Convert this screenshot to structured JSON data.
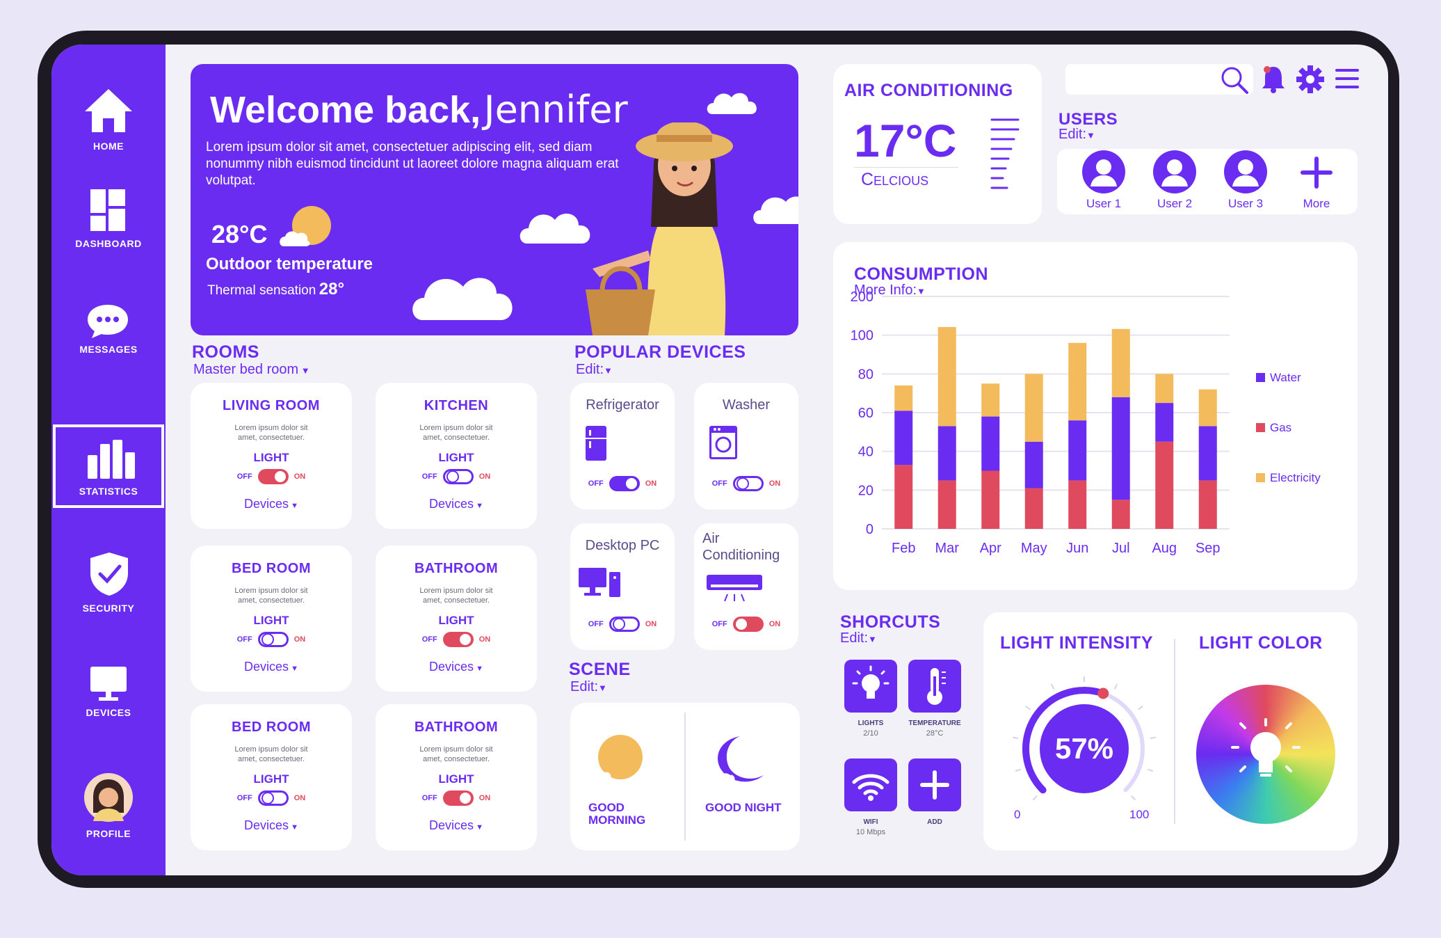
{
  "sidebar": {
    "items": [
      {
        "label": "HOME",
        "icon": "home-icon"
      },
      {
        "label": "DASHBOARD",
        "icon": "dashboard-icon"
      },
      {
        "label": "MESSAGES",
        "icon": "chat-icon"
      },
      {
        "label": "STATISTICS",
        "icon": "bar-chart-icon"
      },
      {
        "label": "SECURITY",
        "icon": "shield-check-icon"
      },
      {
        "label": "DEVICES",
        "icon": "monitor-icon"
      },
      {
        "label": "PROFILE",
        "icon": "avatar"
      }
    ],
    "active": "STATISTICS"
  },
  "welcome": {
    "greeting": "Welcome back,",
    "name": "Jennifer",
    "text": "Lorem ipsum dolor sit amet, consectetuer adipiscing elit, sed diam nonummy nibh euismod tincidunt ut laoreet dolore magna aliquam erat volutpat.",
    "temperature": "28°C",
    "outdoor_label": "Outdoor temperature",
    "thermal_label": "Thermal sensation",
    "thermal_value": "28°"
  },
  "air_conditioning": {
    "title": "AIR CONDITIONING",
    "temperature": "17°C",
    "unit": "Celcious"
  },
  "header": {
    "search_placeholder": "",
    "icons": [
      "search-icon",
      "bell-icon",
      "gear-icon",
      "menu-icon"
    ]
  },
  "users": {
    "title": "USERS",
    "edit": "Edit:",
    "list": [
      "User 1",
      "User 2",
      "User 3"
    ],
    "more": "More"
  },
  "rooms": {
    "title": "ROOMS",
    "subtitle": "Master bed room",
    "list": [
      {
        "name": "LIVING ROOM",
        "desc": "Lorem ipsum dolor sit amet, consectetuer.",
        "light": "LIGHT",
        "state": "on",
        "devices": "Devices"
      },
      {
        "name": "KITCHEN",
        "desc": "Lorem ipsum dolor sit amet, consectetuer.",
        "light": "LIGHT",
        "state": "off",
        "devices": "Devices"
      },
      {
        "name": "BED ROOM",
        "desc": "Lorem ipsum dolor sit amet, consectetuer.",
        "light": "LIGHT",
        "state": "off",
        "devices": "Devices"
      },
      {
        "name": "BATHROOM",
        "desc": "Lorem ipsum dolor sit amet, consectetuer.",
        "light": "LIGHT",
        "state": "on",
        "devices": "Devices"
      },
      {
        "name": "BED ROOM",
        "desc": "Lorem ipsum dolor sit amet, consectetuer.",
        "light": "LIGHT",
        "state": "off",
        "devices": "Devices"
      },
      {
        "name": "BATHROOM",
        "desc": "Lorem ipsum dolor sit amet, consectetuer.",
        "light": "LIGHT",
        "state": "on",
        "devices": "Devices"
      }
    ],
    "off": "OFF",
    "on": "ON"
  },
  "popular_devices": {
    "title": "POPULAR DEVICES",
    "edit": "Edit:",
    "list": [
      {
        "name": "Refrigerator",
        "icon": "fridge-icon",
        "state": "off"
      },
      {
        "name": "Washer",
        "icon": "washer-icon",
        "state": "off"
      },
      {
        "name": "Desktop PC",
        "icon": "desktop-icon",
        "state": "off"
      },
      {
        "name": "Air Conditioning",
        "icon": "ac-icon",
        "state": "on"
      }
    ]
  },
  "scene": {
    "title": "SCENE",
    "edit": "Edit:",
    "morning": "GOOD MORNING",
    "night": "GOOD NIGHT"
  },
  "consumption": {
    "title": "CONSUMPTION",
    "more": "More Info:"
  },
  "chart_data": {
    "type": "bar",
    "stacked": true,
    "categories": [
      "Feb",
      "Mar",
      "Apr",
      "May",
      "Jun",
      "Jul",
      "Aug",
      "Sep"
    ],
    "y_ticks": [
      "0",
      "20",
      "40",
      "60",
      "80",
      "100",
      "200"
    ],
    "series": [
      {
        "name": "Gas",
        "color": "#e04a5e",
        "values": [
          33,
          25,
          30,
          21,
          25,
          15,
          45,
          25
        ]
      },
      {
        "name": "Water",
        "color": "#6a2cf0",
        "values": [
          28,
          28,
          28,
          24,
          31,
          53,
          20,
          28
        ]
      },
      {
        "name": "Electricity",
        "color": "#f3bb5b",
        "values": [
          13,
          68,
          17,
          35,
          40,
          48,
          15,
          19
        ]
      }
    ],
    "legend": [
      "Water",
      "Gas",
      "Electricity"
    ],
    "legend_position": "right",
    "grid": true
  },
  "shortcuts": {
    "title": "SHORCUTS",
    "edit": "Edit:",
    "items": [
      {
        "label": "LIGHTS",
        "sub": "2/10",
        "icon": "bulb-icon"
      },
      {
        "label": "TEMPERATURE",
        "sub": "28°C",
        "icon": "thermometer-icon"
      },
      {
        "label": "WIFI",
        "sub": "10 Mbps",
        "icon": "wifi-icon"
      },
      {
        "label": "ADD",
        "sub": "",
        "icon": "plus-icon"
      }
    ]
  },
  "light_intensity": {
    "title": "LIGHT INTENSITY",
    "value": "57%",
    "level": 0.57,
    "min": "0",
    "max": "100"
  },
  "light_color": {
    "title": "LIGHT COLOR"
  }
}
